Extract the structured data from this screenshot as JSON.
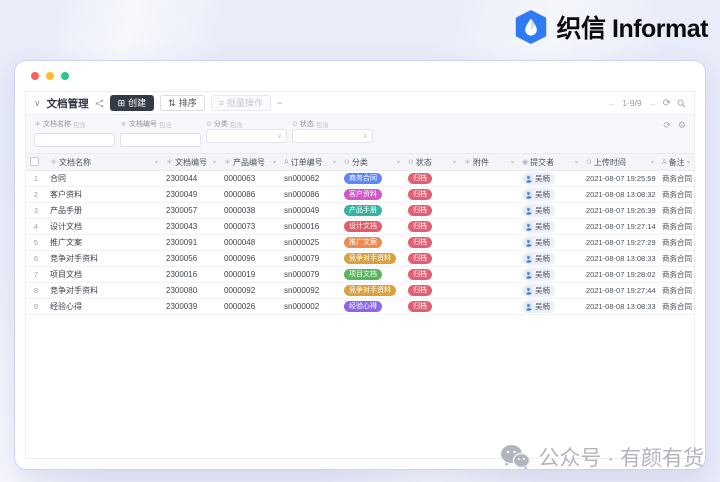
{
  "brand": {
    "name": "织信 Informat"
  },
  "window": {
    "traffic_lights": [
      "#fb5f57",
      "#fdbc2e",
      "#25c78c"
    ]
  },
  "toolbar": {
    "title": "文档管理",
    "create_label": "创建",
    "sort_label": "排序",
    "batch_label": "批量操作",
    "pagination": "1-9/9"
  },
  "filters": [
    {
      "icon": "field_asterisk",
      "label": "文档名称",
      "op": "包含",
      "type": "input",
      "value": ""
    },
    {
      "icon": "field_asterisk",
      "label": "文档编号",
      "op": "包含",
      "type": "input",
      "value": ""
    },
    {
      "icon": "field_circle",
      "label": "分类",
      "op": "包含",
      "type": "select",
      "value": ""
    },
    {
      "icon": "field_circle",
      "label": "状态",
      "op": "包含",
      "type": "select",
      "value": ""
    }
  ],
  "table": {
    "columns": [
      {
        "icon": "field_asterisk",
        "label": "文档名称"
      },
      {
        "icon": "field_asterisk",
        "label": "文档编号"
      },
      {
        "icon": "field_asterisk",
        "label": "产品编号"
      },
      {
        "icon": "field_text",
        "label": "订单编号"
      },
      {
        "icon": "field_circle",
        "label": "分类"
      },
      {
        "icon": "field_circle",
        "label": "状态"
      },
      {
        "icon": "field_asterisk",
        "label": "附件"
      },
      {
        "icon": "field_person",
        "label": "提交者"
      },
      {
        "icon": "field_circle",
        "label": "上传时间"
      },
      {
        "icon": "field_text",
        "label": "备注"
      }
    ],
    "rows": [
      {
        "name": "合同",
        "doc_no": "2300044",
        "product_no": "0000063",
        "order_no": "sn000062",
        "category": "商务合同",
        "category_color": "#5b87f7",
        "status": "归档",
        "status_color": "#e25e72",
        "attachment": "",
        "submitter": "吴楠",
        "upload_time": "2021-08-07 19:25:59",
        "remark": "商务合同"
      },
      {
        "name": "客户资料",
        "doc_no": "2300049",
        "product_no": "0000086",
        "order_no": "sn000086",
        "category": "客户资料",
        "category_color": "#cf59c6",
        "status": "归档",
        "status_color": "#e25e72",
        "attachment": "",
        "submitter": "吴楠",
        "upload_time": "2021-08-08 13:08:32",
        "remark": "商务合同"
      },
      {
        "name": "产品手册",
        "doc_no": "2300057",
        "product_no": "0000038",
        "order_no": "sn000049",
        "category": "产品手册",
        "category_color": "#38b3a0",
        "status": "归档",
        "status_color": "#e25e72",
        "attachment": "",
        "submitter": "吴楠",
        "upload_time": "2021-08-07 19:26:39",
        "remark": "商务合同"
      },
      {
        "name": "设计文档",
        "doc_no": "2300043",
        "product_no": "0000073",
        "order_no": "sn000016",
        "category": "设计文档",
        "category_color": "#e05c68",
        "status": "归档",
        "status_color": "#e25e72",
        "attachment": "",
        "submitter": "吴楠",
        "upload_time": "2021-08-07 19:27:14",
        "remark": "商务合同"
      },
      {
        "name": "推广文案",
        "doc_no": "2300091",
        "product_no": "0000048",
        "order_no": "sn000025",
        "category": "推广文案",
        "category_color": "#ef8a50",
        "status": "归档",
        "status_color": "#e25e72",
        "attachment": "",
        "submitter": "吴楠",
        "upload_time": "2021-08-07 19:27:29",
        "remark": "商务合同"
      },
      {
        "name": "竞争对手资料",
        "doc_no": "2300056",
        "product_no": "0000096",
        "order_no": "sn000079",
        "category": "竞争对手资料",
        "category_color": "#d9a23f",
        "status": "归档",
        "status_color": "#e25e72",
        "attachment": "",
        "submitter": "吴楠",
        "upload_time": "2021-08-08 13:08:33",
        "remark": "商务合同"
      },
      {
        "name": "项目文档",
        "doc_no": "2300016",
        "product_no": "0000019",
        "order_no": "sn000079",
        "category": "项目文档",
        "category_color": "#57b65b",
        "status": "归档",
        "status_color": "#e25e72",
        "attachment": "",
        "submitter": "吴楠",
        "upload_time": "2021-08-07 19:28:02",
        "remark": "商务合同"
      },
      {
        "name": "竞争对手资料",
        "doc_no": "2300080",
        "product_no": "0000092",
        "order_no": "sn000092",
        "category": "竞争对手资料",
        "category_color": "#d9a23f",
        "status": "归档",
        "status_color": "#e25e72",
        "attachment": "",
        "submitter": "吴楠",
        "upload_time": "2021-08-07 19:27:44",
        "remark": "商务合同"
      },
      {
        "name": "经验心得",
        "doc_no": "2300039",
        "product_no": "0000026",
        "order_no": "sn000002",
        "category": "经验心得",
        "category_color": "#8b67e8",
        "status": "归档",
        "status_color": "#e25e72",
        "attachment": "",
        "submitter": "吴楠",
        "upload_time": "2021-08-08 13:08:33",
        "remark": "商务合同"
      }
    ]
  },
  "icons": {
    "chevron_down": "∨",
    "create": "⊞",
    "sort": "⇅",
    "batch": "≡",
    "more": "−",
    "prev": "←",
    "next": "→",
    "refresh": "⟳",
    "gear": "⚙",
    "header_sort": "▾",
    "select_caret": "∨",
    "field_asterisk": "＊",
    "field_text": "A",
    "field_circle": "⊙",
    "field_person": "◉"
  },
  "watermark": {
    "text": "公众号 · 有颜有货"
  },
  "colors": {
    "brand_blue": "#2f7af5",
    "status_archived": "#e25e72"
  }
}
